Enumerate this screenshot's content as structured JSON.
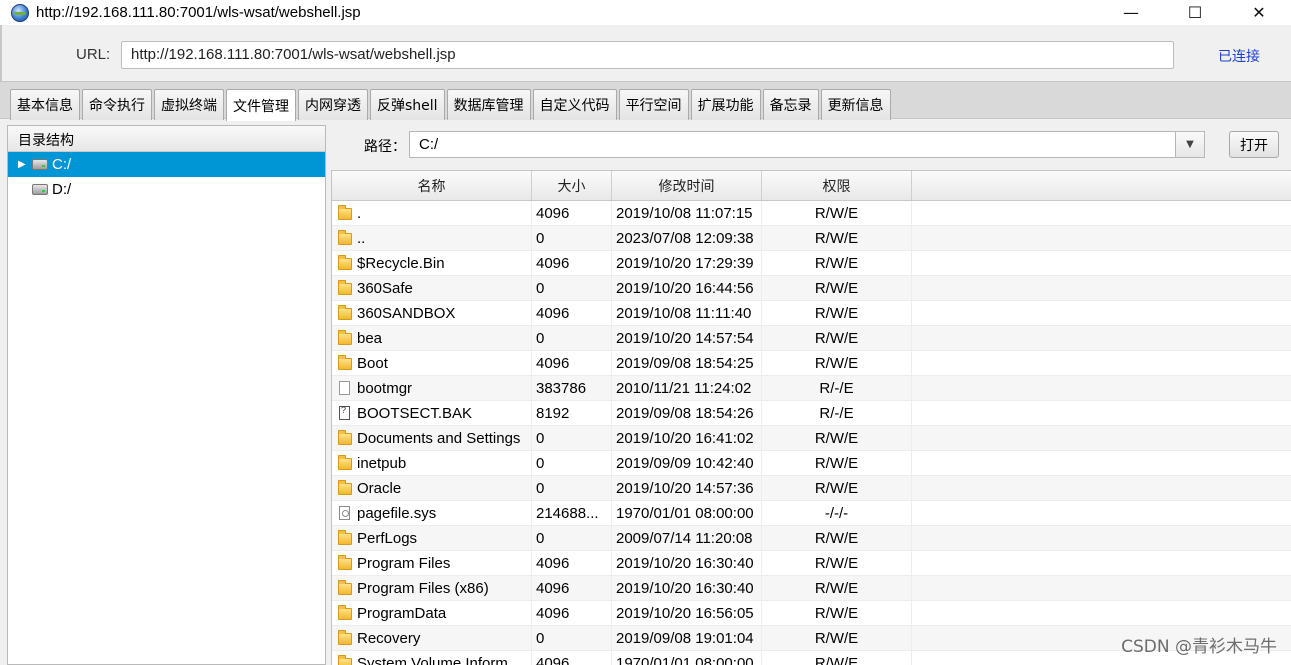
{
  "window": {
    "title": "http://192.168.111.80:7001/wls-wsat/webshell.jsp",
    "minimize_glyph": "—",
    "maximize_glyph": "☐",
    "close_glyph": "✕"
  },
  "urlbar": {
    "label": "URL:",
    "value": "http://192.168.111.80:7001/wls-wsat/webshell.jsp",
    "status": "已连接"
  },
  "tabs": [
    {
      "label": "基本信息"
    },
    {
      "label": "命令执行"
    },
    {
      "label": "虚拟终端"
    },
    {
      "label": "文件管理",
      "active": true
    },
    {
      "label": "内网穿透"
    },
    {
      "label": "反弹shell"
    },
    {
      "label": "数据库管理"
    },
    {
      "label": "自定义代码"
    },
    {
      "label": "平行空间"
    },
    {
      "label": "扩展功能"
    },
    {
      "label": "备忘录"
    },
    {
      "label": "更新信息"
    }
  ],
  "tree": {
    "header": "目录结构",
    "items": [
      {
        "label": "C:/",
        "selected": true,
        "expander": "▶"
      },
      {
        "label": "D:/",
        "selected": false,
        "expander": ""
      }
    ]
  },
  "path": {
    "label": "路径：",
    "value": "C:/",
    "open_label": "打开"
  },
  "table": {
    "headers": {
      "name": "名称",
      "size": "大小",
      "time": "修改时间",
      "perm": "权限"
    },
    "rows": [
      {
        "icon": "folder",
        "name": ".",
        "size": "4096",
        "time": "2019/10/08 11:07:15",
        "perm": "R/W/E"
      },
      {
        "icon": "folder",
        "name": "..",
        "size": "0",
        "time": "2023/07/08 12:09:38",
        "perm": "R/W/E"
      },
      {
        "icon": "folder",
        "name": "$Recycle.Bin",
        "size": "4096",
        "time": "2019/10/20 17:29:39",
        "perm": "R/W/E"
      },
      {
        "icon": "folder",
        "name": "360Safe",
        "size": "0",
        "time": "2019/10/20 16:44:56",
        "perm": "R/W/E"
      },
      {
        "icon": "folder",
        "name": "360SANDBOX",
        "size": "4096",
        "time": "2019/10/08 11:11:40",
        "perm": "R/W/E"
      },
      {
        "icon": "folder",
        "name": "bea",
        "size": "0",
        "time": "2019/10/20 14:57:54",
        "perm": "R/W/E"
      },
      {
        "icon": "folder",
        "name": "Boot",
        "size": "4096",
        "time": "2019/09/08 18:54:25",
        "perm": "R/W/E"
      },
      {
        "icon": "file",
        "name": "bootmgr",
        "size": "383786",
        "time": "2010/11/21 11:24:02",
        "perm": "R/-/E"
      },
      {
        "icon": "sys",
        "name": "BOOTSECT.BAK",
        "size": "8192",
        "time": "2019/09/08 18:54:26",
        "perm": "R/-/E"
      },
      {
        "icon": "folder",
        "name": "Documents and Settings",
        "size": "0",
        "time": "2019/10/20 16:41:02",
        "perm": "R/W/E"
      },
      {
        "icon": "folder",
        "name": "inetpub",
        "size": "0",
        "time": "2019/09/09 10:42:40",
        "perm": "R/W/E"
      },
      {
        "icon": "folder",
        "name": "Oracle",
        "size": "0",
        "time": "2019/10/20 14:57:36",
        "perm": "R/W/E"
      },
      {
        "icon": "page",
        "name": "pagefile.sys",
        "size": "214688...",
        "time": "1970/01/01 08:00:00",
        "perm": "-/-/-"
      },
      {
        "icon": "folder",
        "name": "PerfLogs",
        "size": "0",
        "time": "2009/07/14 11:20:08",
        "perm": "R/W/E"
      },
      {
        "icon": "folder",
        "name": "Program Files",
        "size": "4096",
        "time": "2019/10/20 16:30:40",
        "perm": "R/W/E"
      },
      {
        "icon": "folder",
        "name": "Program Files (x86)",
        "size": "4096",
        "time": "2019/10/20 16:30:40",
        "perm": "R/W/E"
      },
      {
        "icon": "folder",
        "name": "ProgramData",
        "size": "4096",
        "time": "2019/10/20 16:56:05",
        "perm": "R/W/E"
      },
      {
        "icon": "folder",
        "name": "Recovery",
        "size": "0",
        "time": "2019/09/08 19:01:04",
        "perm": "R/W/E"
      },
      {
        "icon": "folder",
        "name": "System Volume Inform...",
        "size": "4096",
        "time": "1970/01/01 08:00:00",
        "perm": "R/W/E"
      }
    ]
  },
  "watermark": "CSDN @青衫木马牛"
}
